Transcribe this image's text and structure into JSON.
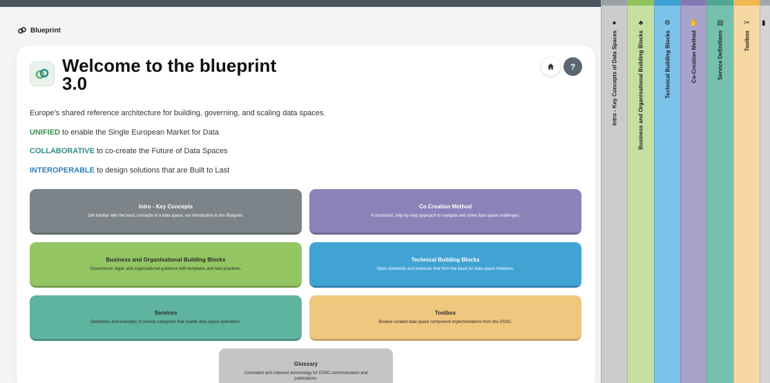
{
  "app": {
    "name": "Blueprint"
  },
  "header": {
    "title": "Welcome to the blueprint 3.0",
    "help_label": "?"
  },
  "intro": {
    "description": "Europe’s shared reference architecture for building, governing, and scaling data spaces.",
    "lines": [
      {
        "keyword": "UNIFIED",
        "rest": " to enable the Single European Market for Data",
        "color": "#3f8a4e"
      },
      {
        "keyword": "COLLABORATIVE",
        "rest": " to co-create the Future of Data Spaces",
        "color": "#2f8a8a"
      },
      {
        "keyword": "INTEROPERABLE",
        "rest": " to design solutions that are Built to Last",
        "color": "#2f7fb5"
      }
    ]
  },
  "tiles": [
    {
      "title": "Intro - Key Concepts",
      "desc": "Get familiar with the basic concepts of a data space, our introduction to the Blueprint.",
      "color": "#7c8489"
    },
    {
      "title": "Co Creation Method",
      "desc": "A structured, step-by-step approach to navigate and solve data space challenges.",
      "color": "#8c82b8"
    },
    {
      "title": "Business and Organisational Building Blocks",
      "desc": "Governance, legal, and organisational guidance with templates and best practices.",
      "color": "#93c562"
    },
    {
      "title": "Technical Building Blocks",
      "desc": "Open standards and protocols that form the basis for data space initiatives.",
      "color": "#41a2d4"
    },
    {
      "title": "Services",
      "desc": "Definitions and examples of service categories that enable data space operations.",
      "color": "#5fb4a0"
    },
    {
      "title": "Toolbox",
      "desc": "Browse curated data space component implementations from the DSSC.",
      "color": "#f0c77e"
    },
    {
      "title": "Glossary",
      "desc": "Consistent and coherent terminology for DSSC communication and publications.",
      "color": "#c3c5c7"
    }
  ],
  "side_tabs": [
    {
      "label": "Intro - Key Concepts of Data Spaces",
      "icon": "lightbulb-icon",
      "glyph": "●",
      "color": "#c9cbcd",
      "top_color": "#9aa0a4"
    },
    {
      "label": "Business and Organisational Building Blocks",
      "icon": "building-blocks-icon",
      "glyph": "♣",
      "color": "#c5df9f",
      "top_color": "#8fc25b"
    },
    {
      "label": "Technical Building Blocks",
      "icon": "gears-icon",
      "glyph": "⚙",
      "color": "#7cc3ea",
      "top_color": "#3d9fd4"
    },
    {
      "label": "Co-Creation Method",
      "icon": "handshake-icon",
      "glyph": "✋",
      "color": "#a9a3cc",
      "top_color": "#8479b5"
    },
    {
      "label": "Service Definitions",
      "icon": "clipboard-icon",
      "glyph": "▤",
      "color": "#76c1ad",
      "top_color": "#4fa891"
    },
    {
      "label": "Toolbox",
      "icon": "tools-icon",
      "glyph": "✂",
      "color": "#f7d8a3",
      "top_color": "#f0b84e"
    },
    {
      "label": "",
      "icon": "glossary-icon",
      "glyph": "▮",
      "color": "#d2d4d6",
      "top_color": "#a3a8ac"
    }
  ]
}
